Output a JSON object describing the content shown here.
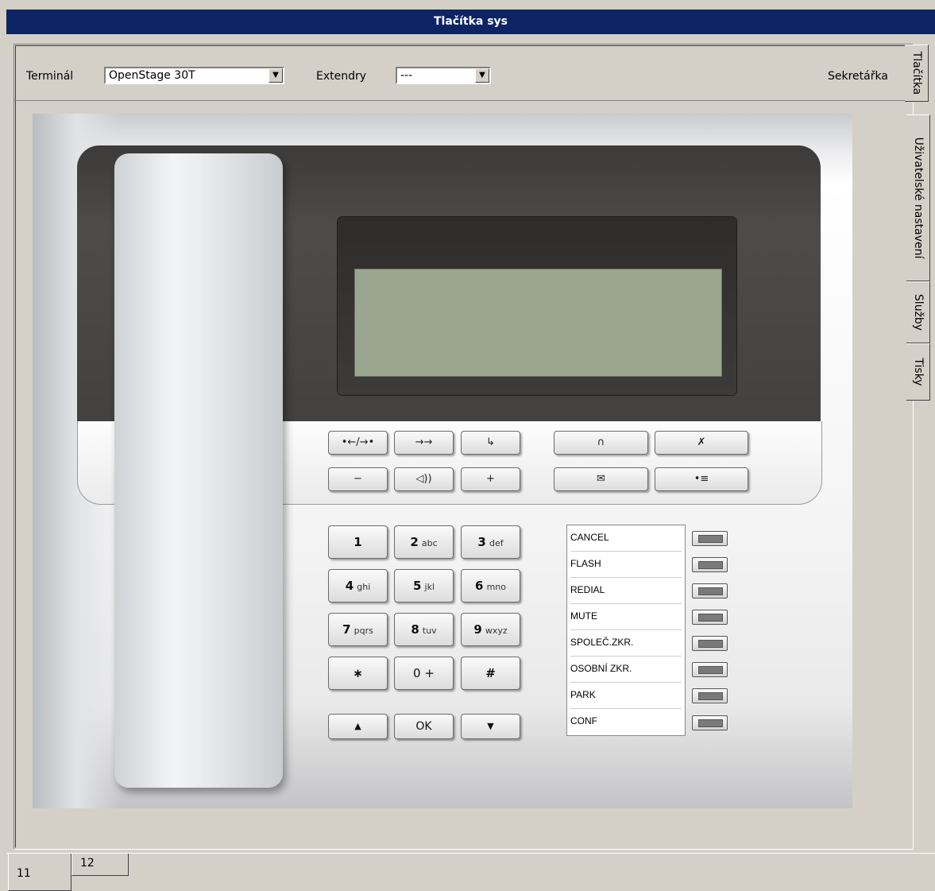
{
  "window": {
    "title": "Tlačítka sys"
  },
  "toolbar": {
    "terminal_label": "Terminál",
    "terminal_value": "OpenStage 30T",
    "extendry_label": "Extendry",
    "extendry_value": "---",
    "secretary_label": "Sekretářka"
  },
  "side_tabs": [
    "Tlačítka",
    "Uživatelské nastavení",
    "Služby",
    "Tisky"
  ],
  "bottom_tabs": [
    "11",
    "12"
  ],
  "phone": {
    "function_keys": [
      "•←/→•",
      "→→",
      "↳",
      "∩",
      "✗",
      "−",
      "◁))",
      "+",
      "✉",
      "•≡"
    ],
    "dialpad": [
      {
        "main": "1",
        "sub": ""
      },
      {
        "main": "2",
        "sub": "abc"
      },
      {
        "main": "3",
        "sub": "def"
      },
      {
        "main": "4",
        "sub": "ghi"
      },
      {
        "main": "5",
        "sub": "jkl"
      },
      {
        "main": "6",
        "sub": "mno"
      },
      {
        "main": "7",
        "sub": "pqrs"
      },
      {
        "main": "8",
        "sub": "tuv"
      },
      {
        "main": "9",
        "sub": "wxyz"
      },
      {
        "main": "∗",
        "sub": ""
      },
      {
        "main": "0 +",
        "sub": ""
      },
      {
        "main": "#",
        "sub": ""
      }
    ],
    "nav_keys": [
      "▲",
      "OK",
      "▼"
    ],
    "programmable_labels": [
      "CANCEL",
      "FLASH",
      "REDIAL",
      "MUTE",
      "SPOLEČ.ZKR.",
      "OSOBNÍ ZKR.",
      "PARK",
      "CONF"
    ]
  }
}
